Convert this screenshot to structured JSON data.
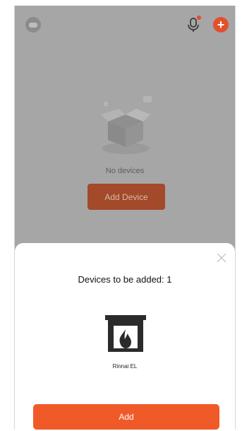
{
  "header": {
    "avatar_icon": "avatar-icon",
    "mic_icon": "microphone-icon",
    "add_icon": "plus-circle-icon",
    "add_icon_glyph": "+"
  },
  "empty_state": {
    "illustration": "empty-box-icon",
    "message": "No devices",
    "button_label": "Add Device"
  },
  "sheet": {
    "close_icon": "close-icon",
    "title": "Devices to be added: 1",
    "device": {
      "icon": "fireplace-icon",
      "name": "Rinnai EL"
    },
    "add_label": "Add"
  },
  "colors": {
    "accent": "#f05a28",
    "overlay": "#a6a6a6"
  }
}
